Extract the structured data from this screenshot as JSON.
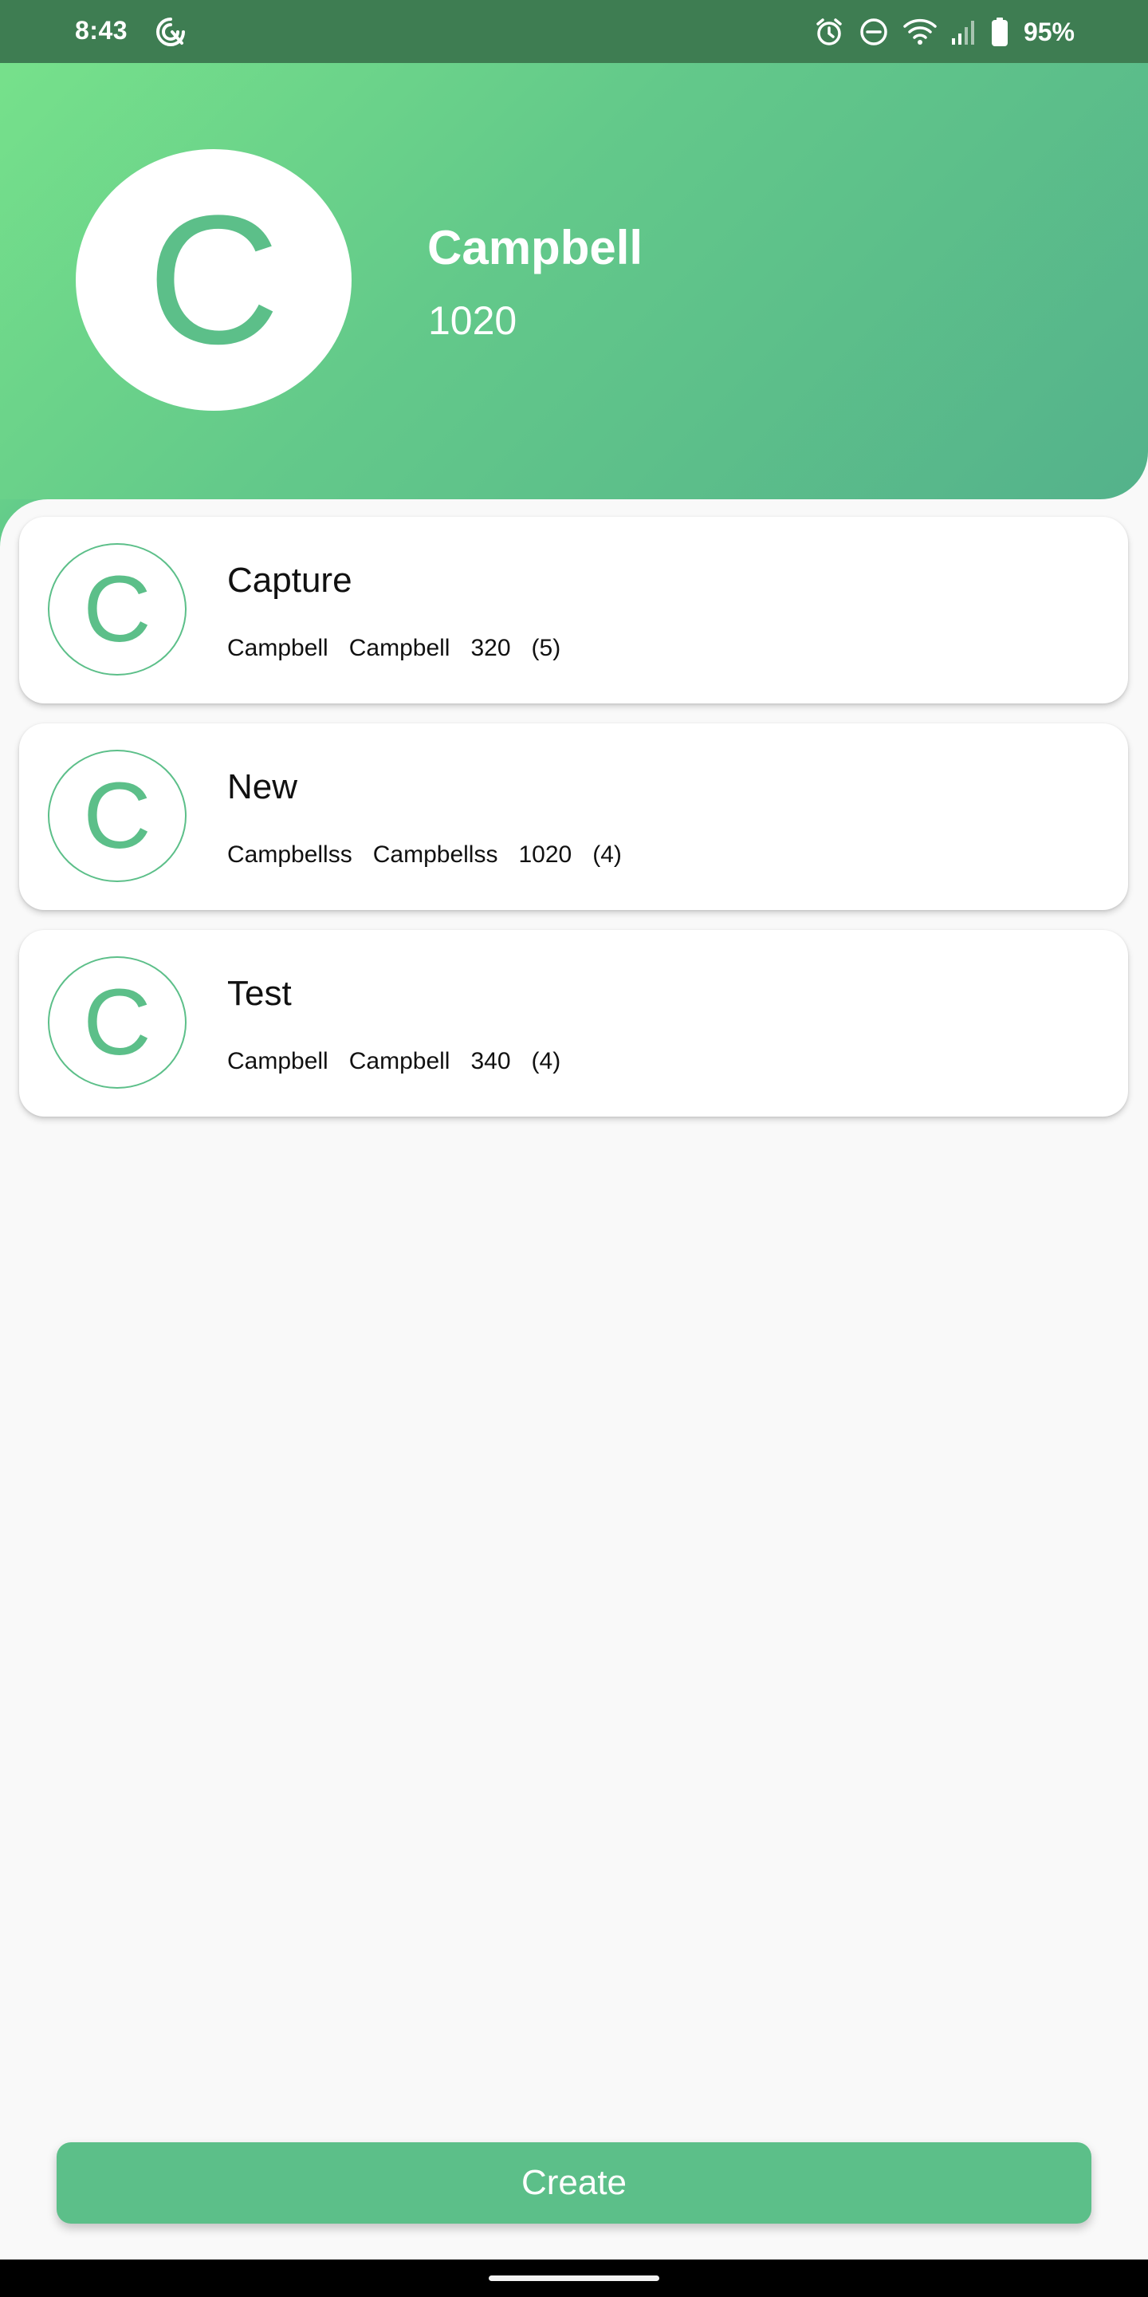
{
  "status_bar": {
    "time": "8:43",
    "battery": "95%",
    "icons": [
      "app-notification-icon",
      "alarm-icon",
      "do-not-disturb-icon",
      "wifi-icon",
      "cell-signal-icon",
      "battery-icon"
    ]
  },
  "profile": {
    "initial": "C",
    "name": "Campbell",
    "score": "1020"
  },
  "cards": [
    {
      "initial": "C",
      "title": "Capture",
      "meta": [
        "Campbell",
        "Campbell",
        "320",
        "(5)"
      ]
    },
    {
      "initial": "C",
      "title": "New",
      "meta": [
        "Campbellss",
        "Campbellss",
        "1020",
        "(4)"
      ]
    },
    {
      "initial": "C",
      "title": "Test",
      "meta": [
        "Campbell",
        "Campbell",
        "340",
        "(4)"
      ]
    }
  ],
  "actions": {
    "create_label": "Create"
  },
  "colors": {
    "accent": "#5cbf89",
    "header_gradient_start": "#78e38b",
    "header_gradient_end": "#54b28b",
    "status_bar": "#3e7d52",
    "background": "#f9f9f9"
  }
}
